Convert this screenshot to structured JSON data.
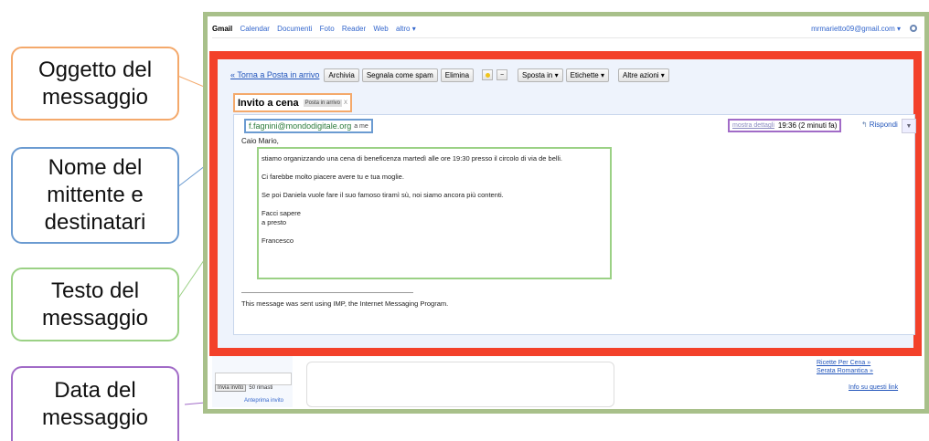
{
  "callouts": [
    {
      "line1": "Oggetto del",
      "line2": "messaggio"
    },
    {
      "line1": "Nome del",
      "line2": "mittente e",
      "line3": "destinatari"
    },
    {
      "line1": "Testo del",
      "line2": "messaggio"
    },
    {
      "line1": "Data del",
      "line2": "messaggio"
    }
  ],
  "gmail": {
    "nav": [
      "Gmail",
      "Calendar",
      "Documenti",
      "Foto",
      "Reader",
      "Web",
      "altro ▾"
    ],
    "account": "mrmarietto09@gmail.com ▾",
    "toolbar": {
      "back": "« Torna a Posta in arrivo",
      "archive": "Archivia",
      "spam": "Segnala come spam",
      "delete": "Elimina",
      "move": "Sposta in ▾",
      "labels": "Etichette ▾",
      "more": "Altre azioni ▾"
    },
    "subject": "Invito a cena",
    "label_chip": "Posta in arrivo",
    "label_x": "X",
    "sender_email": "f.fagnini@mondodigitale.org",
    "recipient": "a me",
    "show_details": "mostra dettagli",
    "date": "19:36 (2 minuti fa)",
    "reply": "Rispondi",
    "greeting": "Caio Mario,",
    "body": [
      "stiamo organizzando una cena di beneficenza martedì alle ore 19:30 presso il circolo di via de belli.",
      "Ci farebbe molto piacere avere tu e tua moglie.",
      "Se poi Daniela vuole fare il suo famoso tiramì sù, noi siamo ancora più contenti."
    ],
    "closing1": "Facci sapere",
    "closing2": "a presto",
    "signoff": "Francesco",
    "signature": "This message was sent using IMP, the Internet Messaging Program.",
    "invite_button": "Invia invito",
    "invites_left": "50 rimasti",
    "chat_link": "Anteprima invito",
    "ads": [
      "Ricette Per Cena »",
      "Serata Romantica »"
    ],
    "ads_info": "Info su questi link"
  },
  "colors": {
    "subject": "#f4a96b",
    "sender": "#6b9bd1",
    "body": "#9bd185",
    "date": "#a16bc7",
    "frame": "#f3412a",
    "screenshot_border": "#a8c08a"
  }
}
